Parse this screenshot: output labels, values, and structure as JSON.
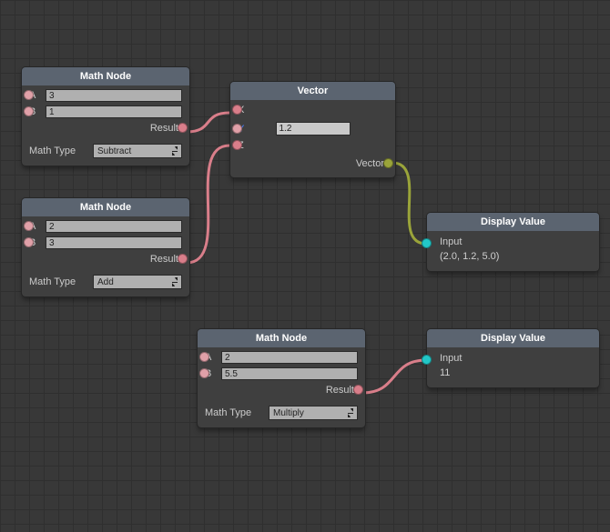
{
  "nodes": {
    "math1": {
      "title": "Math Node",
      "a": "3",
      "b": "1",
      "result_label": "Result",
      "type_label": "Math Type",
      "type_value": "Subtract"
    },
    "math2": {
      "title": "Math Node",
      "a": "2",
      "b": "3",
      "result_label": "Result",
      "type_label": "Math Type",
      "type_value": "Add"
    },
    "math3": {
      "title": "Math Node",
      "a": "2",
      "b": "5.5",
      "result_label": "Result",
      "type_label": "Math Type",
      "type_value": "Multiply"
    },
    "vector": {
      "title": "Vector",
      "x_label": "X",
      "y_label": "Y",
      "z_label": "Z",
      "y_value": "1.2",
      "out_label": "Vector"
    },
    "disp1": {
      "title": "Display Value",
      "input_label": "Input",
      "value": "(2.0, 1.2, 5.0)"
    },
    "disp2": {
      "title": "Display Value",
      "input_label": "Input",
      "value": "11"
    }
  },
  "colors": {
    "pink": "#d97e8a",
    "olive": "#9aa43a",
    "teal": "#22c7c7"
  },
  "wires": [
    {
      "from": "math1.result",
      "to": "vector.x",
      "color": "pink"
    },
    {
      "from": "math2.result",
      "to": "vector.z",
      "color": "pink"
    },
    {
      "from": "vector.out",
      "to": "disp1.in",
      "color": "olive"
    },
    {
      "from": "math3.result",
      "to": "disp2.in",
      "color": "pink"
    }
  ]
}
